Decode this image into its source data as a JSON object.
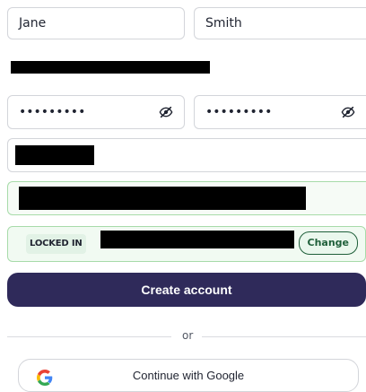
{
  "form": {
    "first_name": "Jane",
    "last_name": "Smith",
    "password_mask": "•••••••••",
    "confirm_password_mask": "•••••••••",
    "locked_tag": "LOCKED IN",
    "change_label": "Change"
  },
  "actions": {
    "create_account": "Create account",
    "divider_or": "or",
    "google": "Continue with Google"
  },
  "colors": {
    "primary": "#2f2a5a",
    "border": "#d3d5da",
    "success_border": "#a7dba9",
    "success_bg": "#f1faf2",
    "change_text": "#1f5f3a"
  },
  "icons": {
    "password_toggle": "eye-slash-icon",
    "google": "google-g-logo-icon"
  }
}
